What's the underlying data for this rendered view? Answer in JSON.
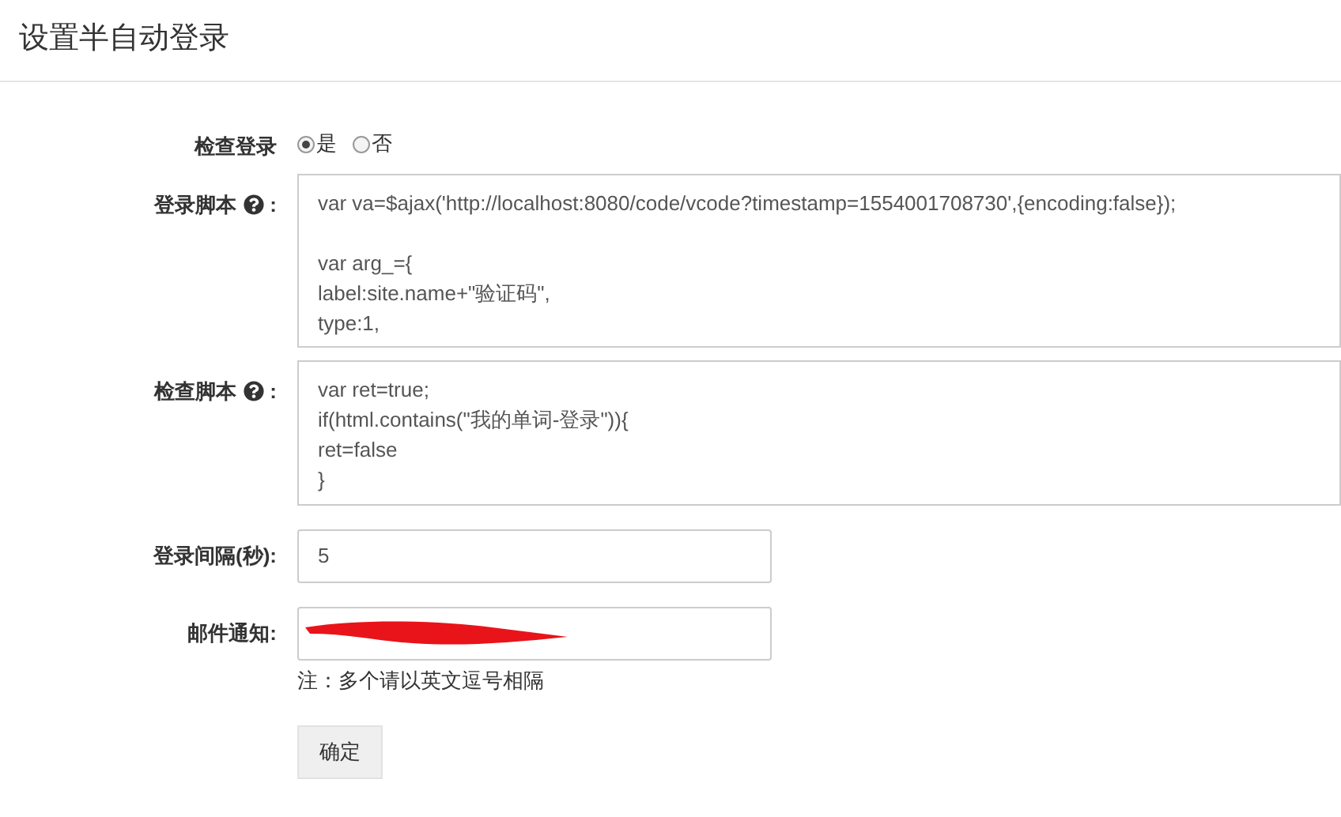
{
  "page": {
    "title": "设置半自动登录"
  },
  "form": {
    "check_login": {
      "label": "检查登录",
      "options": [
        {
          "label": "是",
          "selected": true
        },
        {
          "label": "否",
          "selected": false
        }
      ]
    },
    "login_script": {
      "label": "登录脚本",
      "label_suffix": ":",
      "value": "var va=$ajax('http://localhost:8080/code/vcode?timestamp=1554001708730',{encoding:false});\n\nvar arg_={\nlabel:site.name+\"验证码\",\ntype:1,"
    },
    "check_script": {
      "label": "检查脚本",
      "label_suffix": ":",
      "value": "var ret=true;\nif(html.contains(\"我的单词-登录\")){\nret=false\n}"
    },
    "login_interval": {
      "label": "登录间隔(秒):",
      "value": "5"
    },
    "email_notify": {
      "label": "邮件通知:",
      "redacted": true,
      "note": "注：多个请以英文逗号相隔"
    },
    "submit": {
      "label": "确定"
    }
  }
}
